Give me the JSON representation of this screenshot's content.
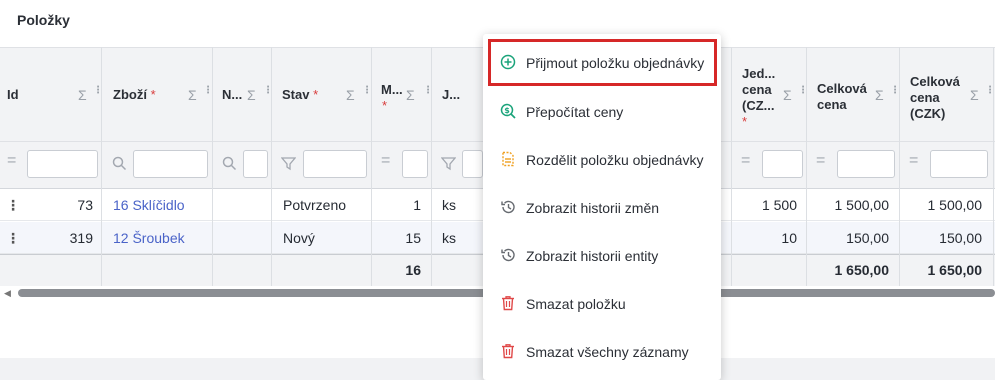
{
  "section": {
    "title": "Položky"
  },
  "columns": [
    {
      "key": "id",
      "label": "Id",
      "required": false
    },
    {
      "key": "zbozi",
      "label": "Zboží",
      "required": true
    },
    {
      "key": "n",
      "label": "N...",
      "required": false
    },
    {
      "key": "stav",
      "label": "Stav",
      "required": true
    },
    {
      "key": "m",
      "label": "M...",
      "required": true
    },
    {
      "key": "j",
      "label": "J...",
      "required": false
    },
    {
      "key": "jed_cena",
      "label_lines": [
        "Jed...",
        "cena",
        "(CZ..."
      ],
      "required": true
    },
    {
      "key": "celkova_cena",
      "label_lines": [
        "Celková",
        "cena"
      ],
      "required": false
    },
    {
      "key": "celkova_cena_czk",
      "label_lines": [
        "Celková",
        "cena",
        "(CZK)"
      ],
      "required": false
    }
  ],
  "rows": [
    {
      "id": "73",
      "zbozi": "16 Sklíčidlo",
      "stav": "Potvrzeno",
      "mnozstvi": "1",
      "jednotka": "ks",
      "jed_cena": "1 500",
      "celkova_cena": "1 500,00",
      "celkova_cena_czk": "1 500,00"
    },
    {
      "id": "319",
      "zbozi": "12 Šroubek",
      "stav": "Nový",
      "mnozstvi": "15",
      "jednotka": "ks",
      "jed_cena": "10",
      "celkova_cena": "150,00",
      "celkova_cena_czk": "150,00"
    }
  ],
  "totals": {
    "mnozstvi": "16",
    "celkova_cena": "1 650,00",
    "celkova_cena_czk": "1 650,00"
  },
  "symbols": {
    "sigma": "Σ",
    "required_mark": "*",
    "equals": "="
  },
  "context_menu": {
    "items": [
      {
        "label": "Přijmout položku objednávky",
        "icon": "plus-circle-icon",
        "color": "#1aa37a",
        "highlighted": true
      },
      {
        "label": "Přepočítat ceny",
        "icon": "search-dollar-icon",
        "color": "#1aa37a"
      },
      {
        "label": "Rozdělit položku objednávky",
        "icon": "split-document-icon",
        "color": "#f0a020"
      },
      {
        "label": "Zobrazit historii změn",
        "icon": "history-icon",
        "color": "#666a70"
      },
      {
        "label": "Zobrazit historii entity",
        "icon": "history-icon",
        "color": "#666a70"
      },
      {
        "label": "Smazat položku",
        "icon": "trash-icon",
        "color": "#e04848"
      },
      {
        "label": "Smazat všechny záznamy",
        "icon": "trash-icon",
        "color": "#e04848"
      }
    ]
  },
  "colors": {
    "link": "#4a63c8",
    "highlight_border": "#d62828",
    "required": "#d83b3b"
  }
}
